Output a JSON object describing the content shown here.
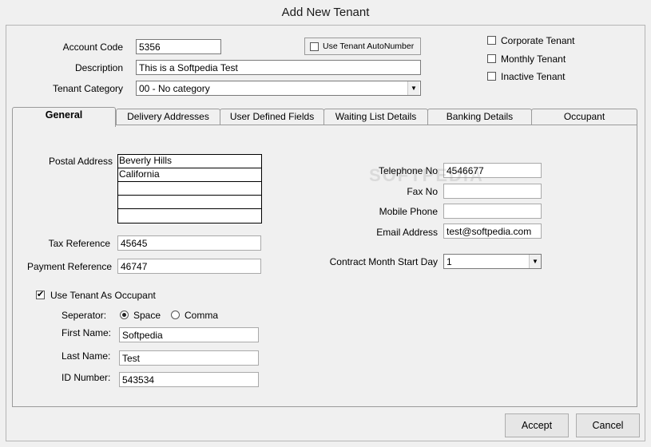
{
  "window": {
    "title": "Add New Tenant"
  },
  "header": {
    "account_code": {
      "label": "Account Code",
      "value": "5356"
    },
    "description": {
      "label": "Description",
      "value": "This is a Softpedia Test"
    },
    "tenant_category": {
      "label": "Tenant Category",
      "value": "00 - No category"
    },
    "autonumber_label": "Use Tenant AutoNumber",
    "corporate_tenant": "Corporate Tenant",
    "monthly_tenant": "Monthly Tenant",
    "inactive_tenant": "Inactive Tenant"
  },
  "tabs": [
    {
      "label": "General"
    },
    {
      "label": "Delivery Addresses"
    },
    {
      "label": "User Defined Fields"
    },
    {
      "label": "Waiting List Details"
    },
    {
      "label": "Banking Details"
    },
    {
      "label": "Occupant"
    }
  ],
  "general": {
    "postal_address_label": "Postal Address",
    "postal_lines": [
      "Beverly Hills",
      "California",
      "",
      "",
      ""
    ],
    "tax_reference": {
      "label": "Tax Reference",
      "value": "45645"
    },
    "payment_reference": {
      "label": "Payment Reference",
      "value": "46747"
    },
    "use_as_occupant": "Use Tenant As Occupant",
    "separator_label": "Seperator:",
    "separator_space": "Space",
    "separator_comma": "Comma",
    "first_name": {
      "label": "First Name:",
      "value": "Softpedia"
    },
    "last_name": {
      "label": "Last Name:",
      "value": "Test"
    },
    "id_number": {
      "label": "ID Number:",
      "value": "543534"
    },
    "telephone": {
      "label": "Telephone No",
      "value": "4546677"
    },
    "fax": {
      "label": "Fax No",
      "value": ""
    },
    "mobile": {
      "label": "Mobile Phone",
      "value": ""
    },
    "email": {
      "label": "Email Address",
      "value": "test@softpedia.com"
    },
    "contract_month": {
      "label": "Contract Month Start Day",
      "value": "1"
    },
    "watermark": "SOFTPEDIA"
  },
  "footer": {
    "accept": "Accept",
    "cancel": "Cancel"
  },
  "icons": {
    "check": "✔",
    "dropdown": "▼"
  }
}
